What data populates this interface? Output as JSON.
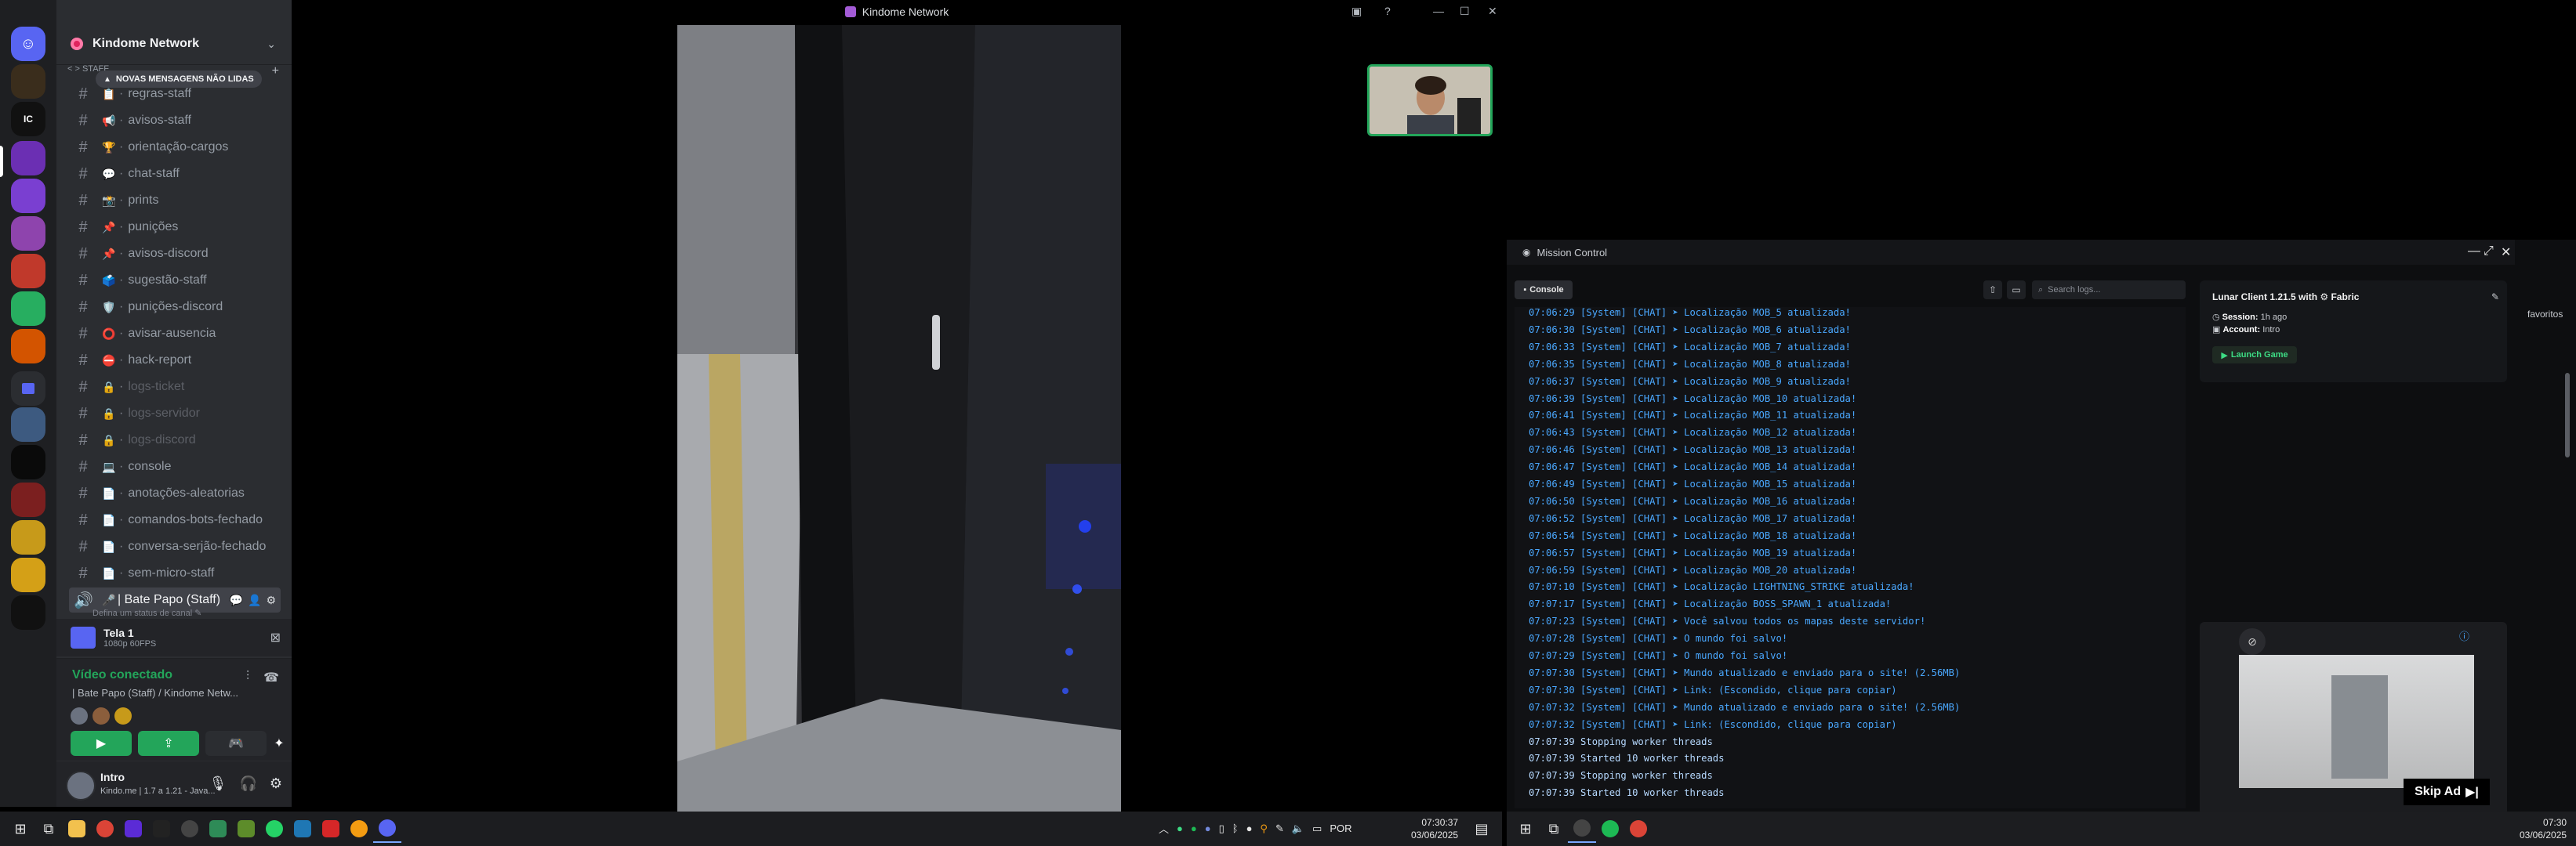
{
  "discord": {
    "guild_name": "Kindome Network",
    "unread_pill": "NOVAS MENSAGENS NÃO LIDAS",
    "category_prefix": "< > STAFF",
    "channels": [
      {
        "emoji": "📋",
        "name": "regras-staff",
        "muted": false
      },
      {
        "emoji": "📢",
        "name": "avisos-staff",
        "muted": false
      },
      {
        "emoji": "🏆",
        "name": "orientação-cargos",
        "muted": false
      },
      {
        "emoji": "💬",
        "name": "chat-staff",
        "muted": false
      },
      {
        "emoji": "📸",
        "name": "prints",
        "muted": false
      },
      {
        "emoji": "📌",
        "name": "punições",
        "muted": false
      },
      {
        "emoji": "📌",
        "name": "avisos-discord",
        "muted": false
      },
      {
        "emoji": "🗳️",
        "name": "sugestão-staff",
        "muted": false
      },
      {
        "emoji": "🛡️",
        "name": "punições-discord",
        "muted": false
      },
      {
        "emoji": "⭕",
        "name": "avisar-ausencia",
        "muted": false
      },
      {
        "emoji": "⛔",
        "name": "hack-report",
        "muted": false
      },
      {
        "emoji": "🔒",
        "name": "logs-ticket",
        "muted": true
      },
      {
        "emoji": "🔒",
        "name": "logs-servidor",
        "muted": true
      },
      {
        "emoji": "🔒",
        "name": "logs-discord",
        "muted": true
      },
      {
        "emoji": "💻",
        "name": "console",
        "muted": false
      },
      {
        "emoji": "📄",
        "name": "anotações-aleatorias",
        "muted": false
      },
      {
        "emoji": "📄",
        "name": "comandos-bots-fechado",
        "muted": false
      },
      {
        "emoji": "📄",
        "name": "conversa-serjão-fechado",
        "muted": false
      },
      {
        "emoji": "📄",
        "name": "sem-micro-staff",
        "muted": false
      }
    ],
    "voice_channel": "| Bate Papo (Staff)",
    "status_hint": "Defina um status de canal ✎",
    "share": {
      "title": "Tela 1",
      "subtitle": "1080p 60FPS"
    },
    "voice": {
      "status": "Vídeo conectado",
      "channel": "| Bate Papo (Staff) / Kindome Netw..."
    },
    "user": {
      "name": "Intro",
      "activity": "Kindo.me | 1.7 a 1.21 - Java..."
    }
  },
  "stage": {
    "title": "Kindome Network"
  },
  "launcher": {
    "title": "Mission Control",
    "console_tab": "Console",
    "search_placeholder": "Search logs...",
    "log_lines": [
      "07:06:29 [System] [CHAT] ➤ Localização MOB_5 atualizada!",
      "07:06:30 [System] [CHAT] ➤ Localização MOB_6 atualizada!",
      "07:06:33 [System] [CHAT] ➤ Localização MOB_7 atualizada!",
      "07:06:35 [System] [CHAT] ➤ Localização MOB_8 atualizada!",
      "07:06:37 [System] [CHAT] ➤ Localização MOB_9 atualizada!",
      "07:06:39 [System] [CHAT] ➤ Localização MOB_10 atualizada!",
      "07:06:41 [System] [CHAT] ➤ Localização MOB_11 atualizada!",
      "07:06:43 [System] [CHAT] ➤ Localização MOB_12 atualizada!",
      "07:06:46 [System] [CHAT] ➤ Localização MOB_13 atualizada!",
      "07:06:47 [System] [CHAT] ➤ Localização MOB_14 atualizada!",
      "07:06:49 [System] [CHAT] ➤ Localização MOB_15 atualizada!",
      "07:06:50 [System] [CHAT] ➤ Localização MOB_16 atualizada!",
      "07:06:52 [System] [CHAT] ➤ Localização MOB_17 atualizada!",
      "07:06:54 [System] [CHAT] ➤ Localização MOB_18 atualizada!",
      "07:06:57 [System] [CHAT] ➤ Localização MOB_19 atualizada!",
      "07:06:59 [System] [CHAT] ➤ Localização MOB_20 atualizada!",
      "07:07:10 [System] [CHAT] ➤ Localização LIGHTNING_STRIKE atualizada!",
      "07:07:17 [System] [CHAT] ➤ Localização BOSS_SPAWN_1 atualizada!",
      "07:07:23 [System] [CHAT] ➤ Você salvou todos os mapas deste servidor!",
      "07:07:28 [System] [CHAT] ➤ O mundo foi salvo!",
      "07:07:29 [System] [CHAT] ➤ O mundo foi salvo!",
      "07:07:30 [System] [CHAT] ➤ Mundo atualizado e enviado para o site! (2.56MB)",
      "07:07:30 [System] [CHAT] ➤ Link: (Escondido, clique para copiar)",
      "07:07:32 [System] [CHAT] ➤ Mundo atualizado e enviado para o site! (2.56MB)",
      "07:07:32 [System] [CHAT] ➤ Link: (Escondido, clique para copiar)",
      "07:07:39 Stopping worker threads",
      "07:07:39 Started 10 worker threads",
      "07:07:39 Stopping worker threads",
      "07:07:39 Started 10 worker threads"
    ],
    "profile": {
      "title": "Lunar Client 1.21.5 with",
      "loader": "Fabric",
      "session_label": "Session:",
      "session_value": "1h ago",
      "account_label": "Account:",
      "account_value": "Intro",
      "launch_label": "Launch Game"
    },
    "ad": {
      "skip_label": "Skip Ad"
    }
  },
  "right_strip": {
    "favorites": "favoritos"
  },
  "taskbar_left": {
    "lang": "POR",
    "time": "07:30:37",
    "date": "03/06/2025"
  },
  "taskbar_right": {
    "time": "07:30",
    "date": "03/06/2025"
  },
  "colors": {
    "discord_green": "#23a55a",
    "log_blue": "#4aa8ff",
    "launch_green": "#3ddc84",
    "accent": "#5865f2"
  }
}
